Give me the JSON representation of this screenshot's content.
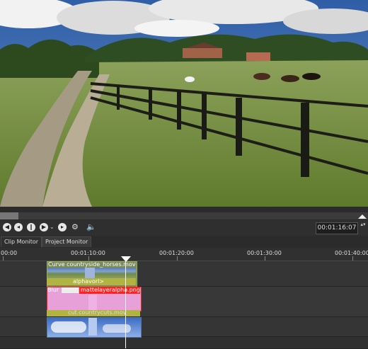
{
  "monitor": {
    "scene": "countryside-horses-frame"
  },
  "transport": {
    "buttons": [
      "skip-start-icon",
      "play-reverse-icon",
      "rewind-icon",
      "play-icon",
      "skip-end-icon"
    ],
    "timecode": "00:01:16:07",
    "spinner": "▴▾"
  },
  "tabs": {
    "clip_monitor": "Clip Monitor",
    "project_monitor": "Project Monitor"
  },
  "ruler": {
    "labels": [
      "00:00",
      "00:01:10:00",
      "00:01:20:00",
      "00:01:30:00",
      "00:01:40:00"
    ]
  },
  "tracks": {
    "video1": {
      "clip_title": "Curve countryside_horses.mov",
      "effect_label": "alphavorl>"
    },
    "video2": {
      "blur_label": "Blur",
      "clip_title": "mattelayeralpha.png",
      "effect_label": "cut.countrycuts.mov"
    }
  },
  "colors": {
    "accent": "#ff2020",
    "effect": "#b2b442",
    "matte": "#e8a0d8"
  }
}
